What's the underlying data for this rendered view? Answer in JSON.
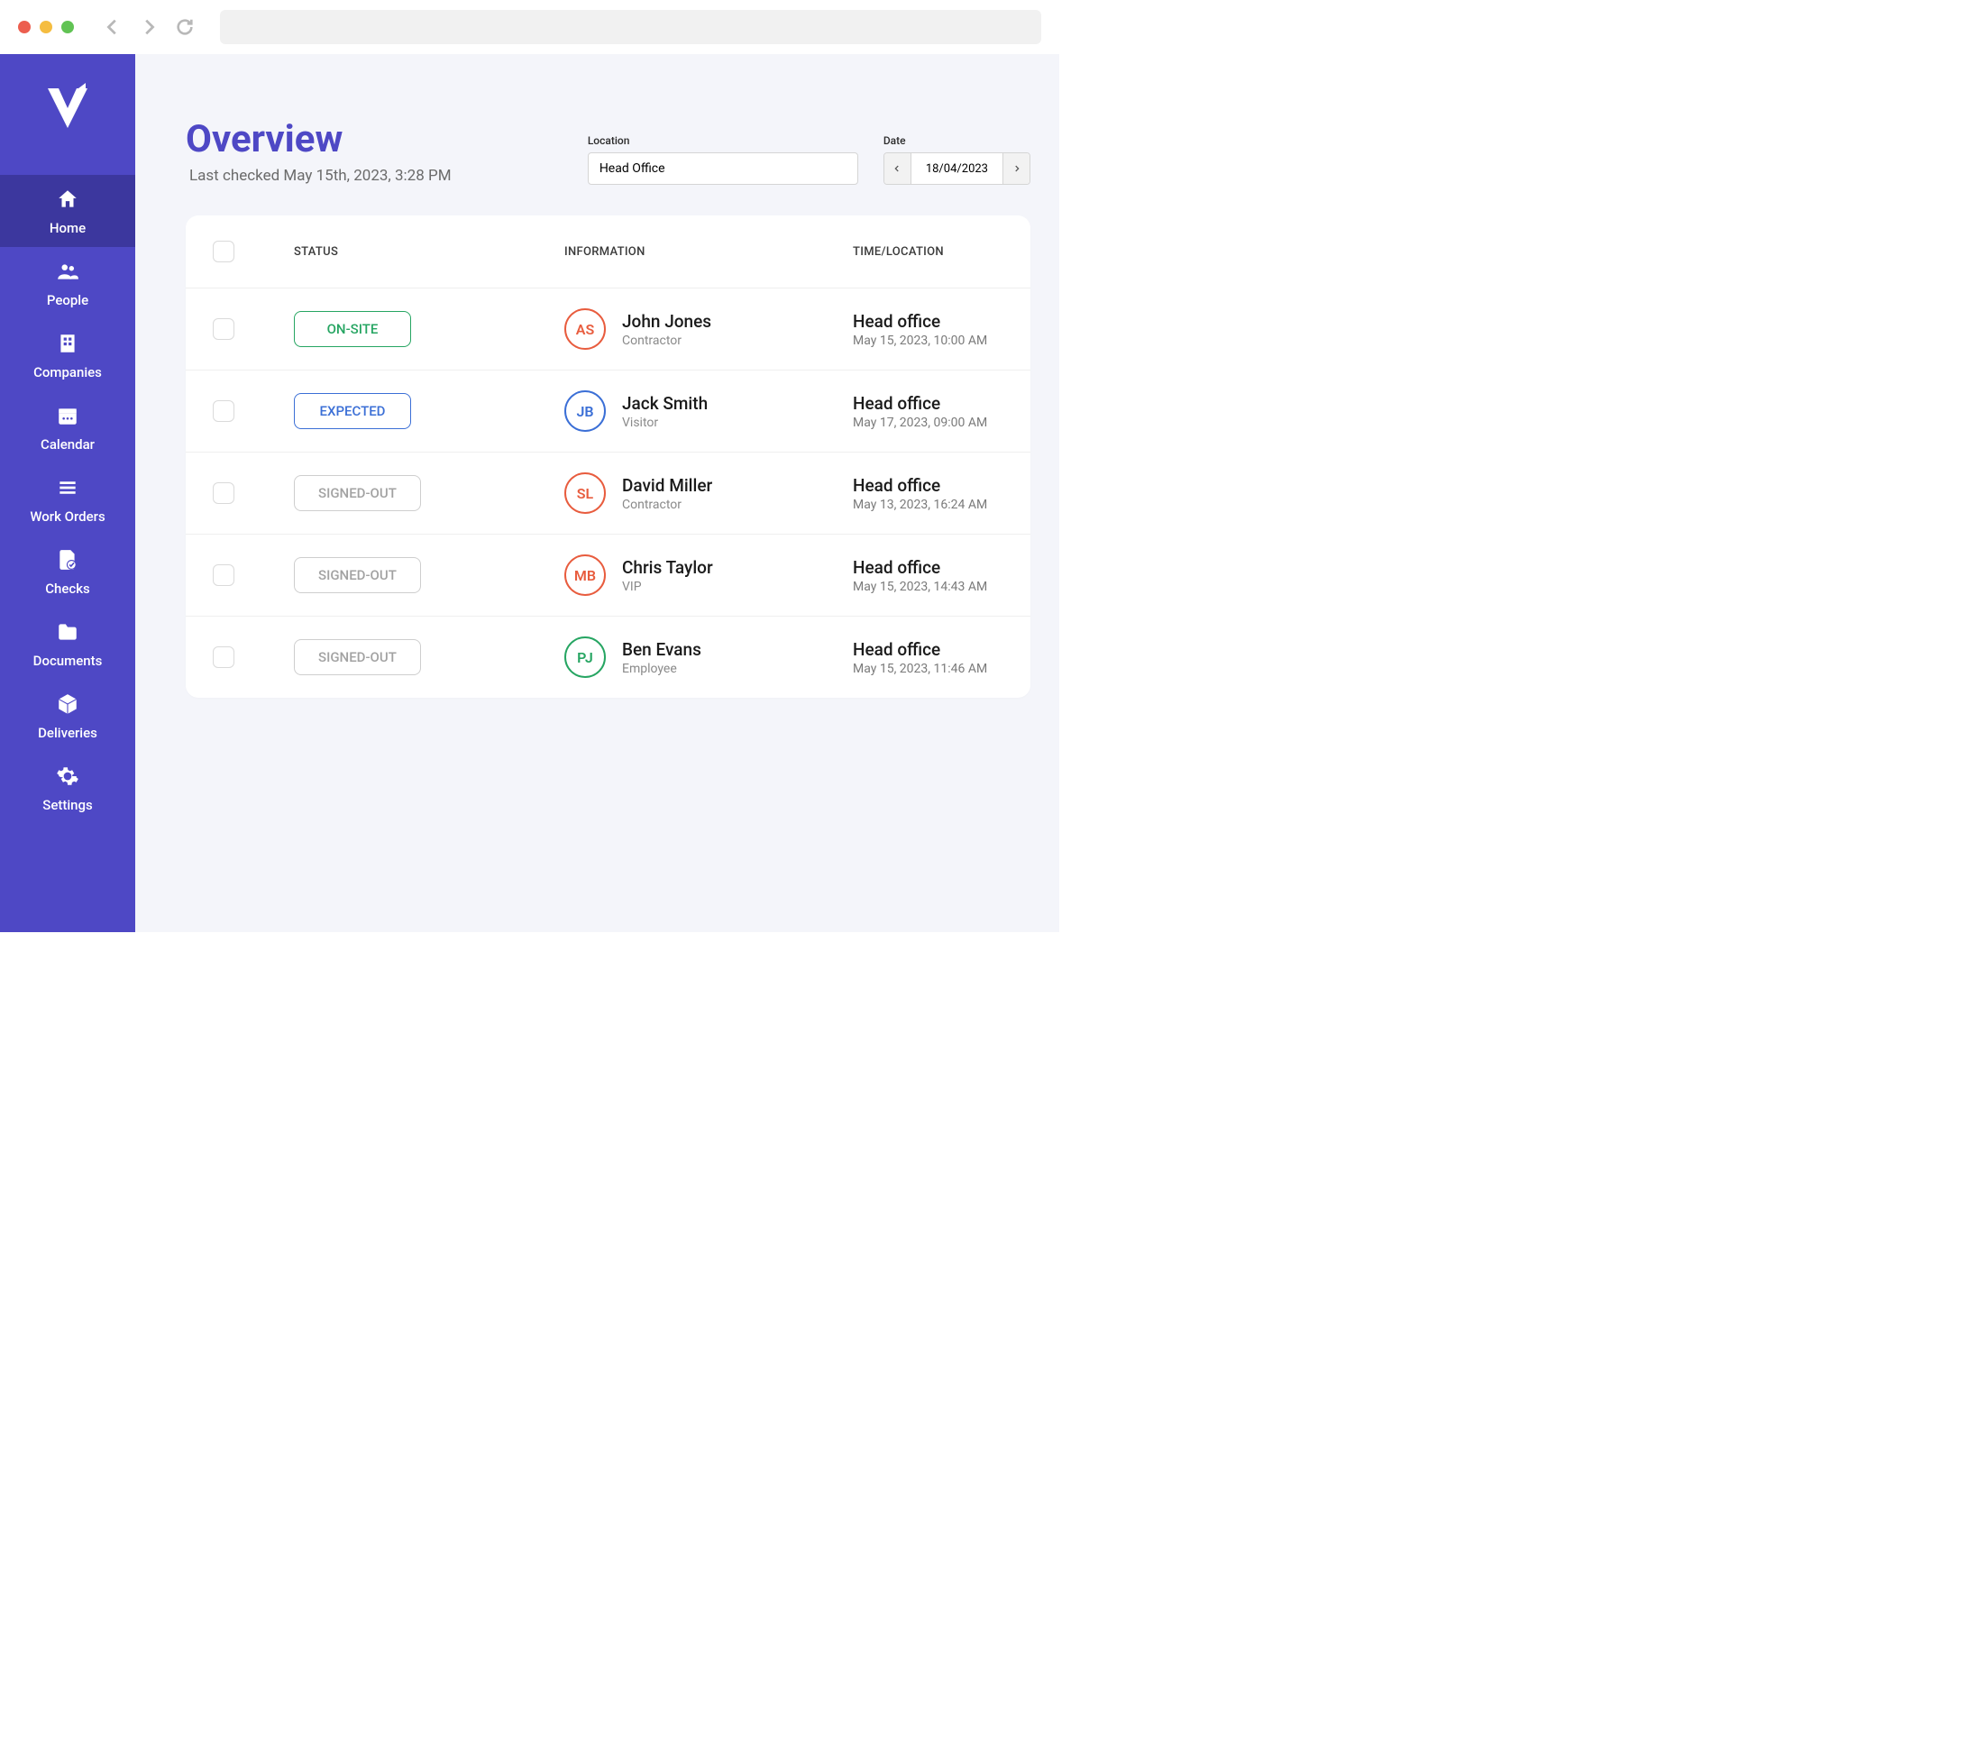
{
  "sidebar": {
    "items": [
      {
        "label": "Home"
      },
      {
        "label": "People"
      },
      {
        "label": "Companies"
      },
      {
        "label": "Calendar"
      },
      {
        "label": "Work Orders"
      },
      {
        "label": "Checks"
      },
      {
        "label": "Documents"
      },
      {
        "label": "Deliveries"
      },
      {
        "label": "Settings"
      }
    ]
  },
  "page": {
    "title": "Overview",
    "subtitle": "Last checked May 15th, 2023, 3:28 PM"
  },
  "filters": {
    "location_label": "Location",
    "location_value": "Head Office",
    "date_label": "Date",
    "date_value": "18/04/2023"
  },
  "table": {
    "headers": {
      "status": "STATUS",
      "information": "INFORMATION",
      "timelocation": "TIME/LOCATION"
    },
    "rows": [
      {
        "status_label": "ON-SITE",
        "status_class": "status-on-site",
        "initials": "AS",
        "avatar_class": "avatar-red",
        "name": "John Jones",
        "role": "Contractor",
        "loc": "Head office",
        "time": "May 15, 2023, 10:00 AM"
      },
      {
        "status_label": "EXPECTED",
        "status_class": "status-expected",
        "initials": "JB",
        "avatar_class": "avatar-blue",
        "name": "Jack Smith",
        "role": "Visitor",
        "loc": "Head office",
        "time": "May 17, 2023, 09:00 AM"
      },
      {
        "status_label": "SIGNED-OUT",
        "status_class": "status-signed-out",
        "initials": "SL",
        "avatar_class": "avatar-red",
        "name": "David Miller",
        "role": "Contractor",
        "loc": "Head office",
        "time": "May 13, 2023, 16:24 AM"
      },
      {
        "status_label": "SIGNED-OUT",
        "status_class": "status-signed-out",
        "initials": "MB",
        "avatar_class": "avatar-red",
        "name": "Chris Taylor",
        "role": "VIP",
        "loc": "Head office",
        "time": "May 15, 2023, 14:43 AM"
      },
      {
        "status_label": "SIGNED-OUT",
        "status_class": "status-signed-out",
        "initials": "PJ",
        "avatar_class": "avatar-green",
        "name": "Ben Evans",
        "role": "Employee",
        "loc": "Head office",
        "time": "May 15, 2023, 11:46 AM"
      }
    ]
  }
}
